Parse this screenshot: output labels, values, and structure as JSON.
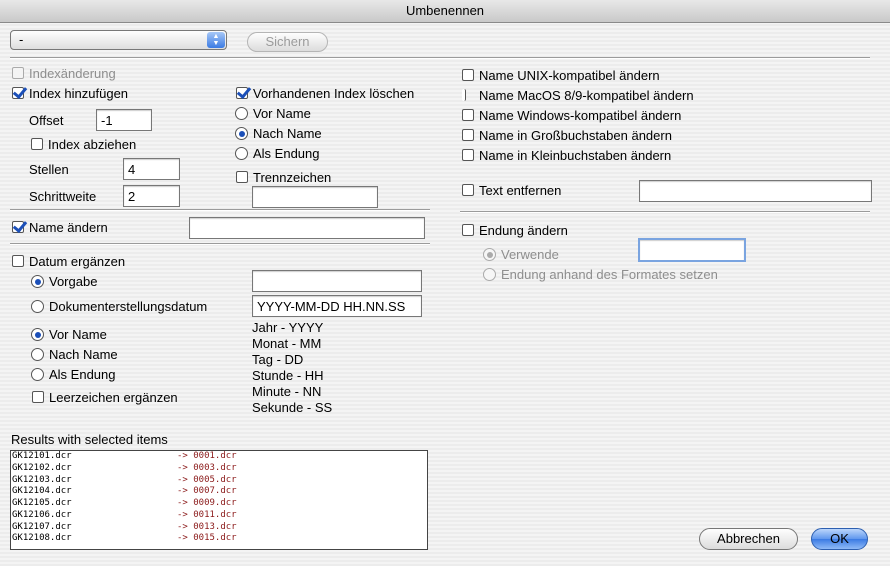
{
  "window": {
    "title": "Umbenennen"
  },
  "toolbar": {
    "preset_value": "-",
    "save_label": "Sichern"
  },
  "index": {
    "change_label": "Indexänderung",
    "add_label": "Index hinzufügen",
    "offset_label": "Offset",
    "offset_value": "-1",
    "subtract_label": "Index abziehen",
    "digits_label": "Stellen",
    "digits_value": "4",
    "step_label": "Schrittweite",
    "step_value": "2",
    "delete_existing_label": "Vorhandenen Index löschen",
    "pos_before": "Vor Name",
    "pos_after": "Nach Name",
    "pos_ext": "Als Endung",
    "separator_label": "Trennzeichen",
    "separator_value": ""
  },
  "rename": {
    "label": "Name ändern",
    "value": ""
  },
  "date": {
    "label": "Datum ergänzen",
    "default_label": "Vorgabe",
    "default_value": "",
    "created_label": "Dokumenterstellungsdatum",
    "format_value": "YYYY-MM-DD HH.NN.SS",
    "pos_before": "Vor Name",
    "pos_after": "Nach Name",
    "pos_ext": "Als Endung",
    "space_label": "Leerzeichen ergänzen",
    "legend": [
      "Jahr - YYYY",
      "Monat - MM",
      "Tag - DD",
      "Stunde - HH",
      "Minute - NN",
      "Sekunde - SS"
    ]
  },
  "name_options": [
    "Name UNIX-kompatibel ändern",
    "Name MacOS 8/9-kompatibel ändern",
    "Name Windows-kompatibel ändern",
    "Name in Großbuchstaben ändern",
    "Name in Kleinbuchstaben ändern"
  ],
  "remove_text": {
    "label": "Text entfernen",
    "value": ""
  },
  "extension": {
    "label": "Endung ändern",
    "use_label": "Verwende",
    "use_value": "",
    "by_format_label": "Endung anhand des Formates setzen"
  },
  "results": {
    "label": "Results with selected items",
    "rows": [
      {
        "src": "GK12101.dcr",
        "dst": "-> 0001.dcr"
      },
      {
        "src": "GK12102.dcr",
        "dst": "-> 0003.dcr"
      },
      {
        "src": "GK12103.dcr",
        "dst": "-> 0005.dcr"
      },
      {
        "src": "GK12104.dcr",
        "dst": "-> 0007.dcr"
      },
      {
        "src": "GK12105.dcr",
        "dst": "-> 0009.dcr"
      },
      {
        "src": "GK12106.dcr",
        "dst": "-> 0011.dcr"
      },
      {
        "src": "GK12107.dcr",
        "dst": "-> 0013.dcr"
      },
      {
        "src": "GK12108.dcr",
        "dst": "-> 0015.dcr"
      }
    ]
  },
  "buttons": {
    "cancel": "Abbrechen",
    "ok": "OK"
  },
  "colors": {
    "accent": "#3b7be3",
    "result_dest": "#8b1a1a"
  }
}
